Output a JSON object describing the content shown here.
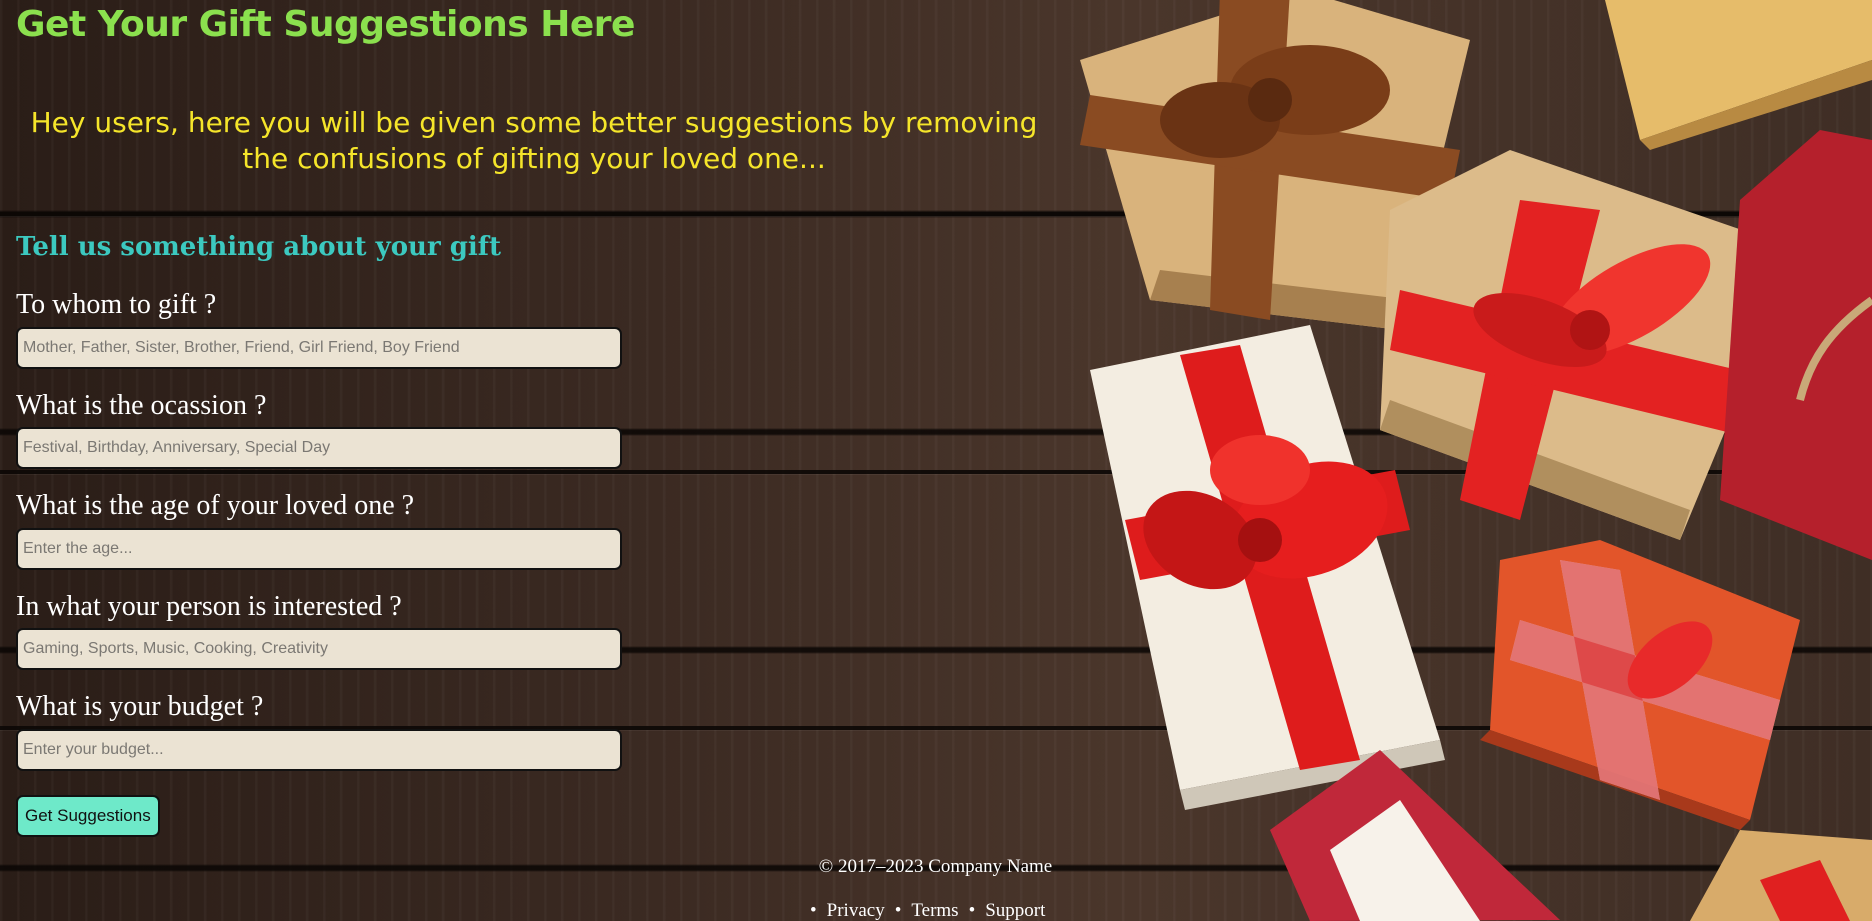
{
  "header": {
    "title": "Get Your Gift Suggestions Here",
    "intro": "Hey users, here you will be given some better suggestions by removing the confusions of gifting your loved one..."
  },
  "form": {
    "heading": "Tell us something about your gift",
    "fields": [
      {
        "label": "To whom to gift ?",
        "placeholder": "Mother, Father, Sister, Brother, Friend, Girl Friend, Boy Friend",
        "value": ""
      },
      {
        "label": "What is the ocassion ?",
        "placeholder": "Festival, Birthday, Anniversary, Special Day",
        "value": ""
      },
      {
        "label": "What is the age of your loved one ?",
        "placeholder": "Enter the age...",
        "value": ""
      },
      {
        "label": "In what your person is interested ?",
        "placeholder": "Gaming, Sports, Music, Cooking, Creativity",
        "value": ""
      },
      {
        "label": "What is your budget ?",
        "placeholder": "Enter your budget...",
        "value": ""
      }
    ],
    "submit_label": "Get Suggestions"
  },
  "footer": {
    "copyright": "© 2017–2023 Company Name",
    "links": [
      "Privacy",
      "Terms",
      "Support"
    ],
    "bullet": "•"
  },
  "colors": {
    "title": "#8be04e",
    "intro": "#f5e52a",
    "heading": "#3cc9c0",
    "button": "#6ee9c9",
    "input_bg": "#ebe3d3"
  }
}
